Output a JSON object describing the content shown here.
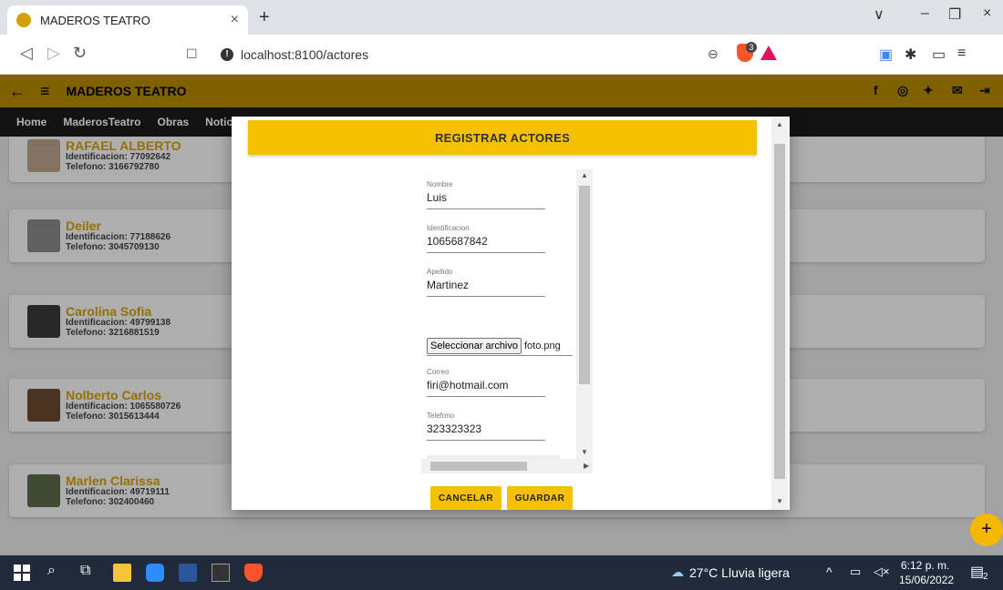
{
  "browser": {
    "tab_title": "MADEROS TEATRO",
    "tab_close": "×",
    "new_tab": "+",
    "url": "localhost:8100/actores",
    "brave_badge": "3",
    "window_controls": [
      "∨",
      "–",
      "❐",
      "×"
    ]
  },
  "app": {
    "title": "MADEROS TEATRO",
    "nav": [
      "Home",
      "MaderosTeatro",
      "Obras",
      "Notic"
    ],
    "social_icons": [
      "facebook-icon",
      "instagram-icon",
      "twitter-icon",
      "mail-icon",
      "logout-icon"
    ]
  },
  "actors": [
    {
      "name": "RAFAEL ALBERTO",
      "id": "Identificacion: 77092642",
      "phone": "Telefono: 3166792780"
    },
    {
      "name": "Deiler",
      "id": "Identificacion: 77188626",
      "phone": "Telefono: 3045709130"
    },
    {
      "name": "Carolina Sofia",
      "id": "Identificacion: 49799138",
      "phone": "Telefono: 3216881519"
    },
    {
      "name": "Nolberto Carlos",
      "id": "Identificacion: 1065580726",
      "phone": "Telefono: 3015613444"
    },
    {
      "name": "Marlen Clarissa",
      "id": "Identificacion: 49719111",
      "phone": "Telefono: 302400460"
    }
  ],
  "modal": {
    "title": "REGISTRAR ACTORES",
    "fields": {
      "nombre": {
        "label": "Nombre",
        "value": "Luis"
      },
      "identificacion": {
        "label": "Identificacion",
        "value": "1065687842"
      },
      "apellido": {
        "label": "Apellido",
        "value": "Martinez"
      },
      "correo": {
        "label": "Correo",
        "value": "firi@hotmail.com"
      },
      "telefono": {
        "label": "Telefono",
        "value": "323323323"
      }
    },
    "file_button": "Seleccionar archivo",
    "file_name": "foto.png",
    "cancel": "CANCELAR",
    "save": "GUARDAR"
  },
  "fab": "+",
  "taskbar": {
    "weather": "27°C  Lluvia ligera",
    "time": "6:12 p. m.",
    "date": "15/06/2022",
    "notification_count": "2"
  },
  "colors": {
    "accent": "#f5c000",
    "header": "#b88c00",
    "taskbar": "#1f2a3a"
  }
}
